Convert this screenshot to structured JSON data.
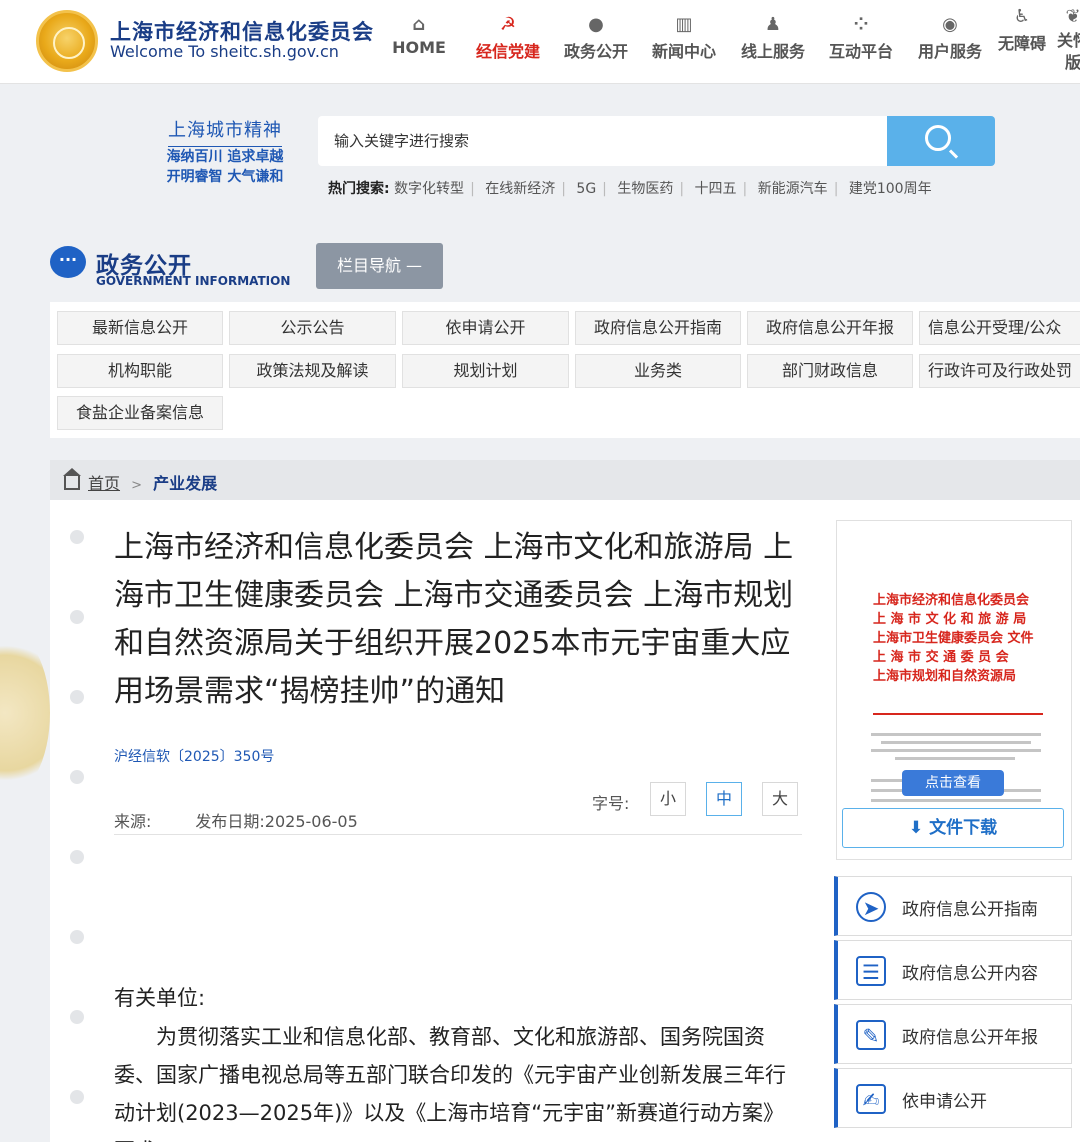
{
  "header": {
    "site_title_cn": "上海市经济和信息化委员会",
    "site_title_en": "Welcome To sheitc.sh.gov.cn",
    "nav": [
      {
        "label": "HOME",
        "icon": "home-icon",
        "glyph": "⌂"
      },
      {
        "label": "经信党建",
        "icon": "party-emblem-icon",
        "glyph": "☭"
      },
      {
        "label": "政务公开",
        "icon": "chat-icon",
        "glyph": "●"
      },
      {
        "label": "新闻中心",
        "icon": "books-icon",
        "glyph": "▥"
      },
      {
        "label": "线上服务",
        "icon": "user-service-icon",
        "glyph": "♟"
      },
      {
        "label": "互动平台",
        "icon": "interact-icon",
        "glyph": "⁘"
      },
      {
        "label": "用户服务",
        "icon": "user-icon",
        "glyph": "◉"
      },
      {
        "label": "无障碍",
        "icon": "accessibility-icon",
        "glyph": "♿"
      },
      {
        "label": "关怀版",
        "icon": "care-icon",
        "glyph": "❦"
      }
    ]
  },
  "spirit": {
    "title": "上海城市精神",
    "line1": "海纳百川 追求卓越",
    "line2": "开明睿智 大气谦和"
  },
  "search": {
    "placeholder": "输入关键字进行搜索",
    "hot_label": "热门搜索:",
    "hot_keywords": [
      "数字化转型",
      "在线新经济",
      "5G",
      "生物医药",
      "十四五",
      "新能源汽车",
      "建党100周年"
    ]
  },
  "gov_info": {
    "title_cn": "政务公开",
    "title_en": "GOVERNMENT INFORMATION",
    "column_nav": "栏目导航 —"
  },
  "categories": [
    "最新信息公开",
    "公示公告",
    "依申请公开",
    "政府信息公开指南",
    "政府信息公开年报",
    "信息公开受理/公众",
    "机构职能",
    "政策法规及解读",
    "规划计划",
    "业务类",
    "部门财政信息",
    "行政许可及行政处罚",
    "食盐企业备案信息"
  ],
  "breadcrumb": {
    "home": "首页",
    "sep": ">",
    "current": "产业发展"
  },
  "article": {
    "title": "上海市经济和信息化委员会 上海市文化和旅游局 上海市卫生健康委员会 上海市交通委员会 上海市规划和自然资源局关于组织开展2025本市元宇宙重大应用场景需求“揭榜挂帅”的通知",
    "doc_no": "沪经信软〔2025〕350号",
    "source_label": "来源:",
    "date_label": "发布日期:2025-06-05",
    "font_size_label": "字号:",
    "font_sizes": [
      "小",
      "中",
      "大"
    ],
    "addressee": "有关单位:",
    "body": "为贯彻落实工业和信息化部、教育部、文化和旅游部、国务院国资委、国家广播电视总局等五部门联合印发的《元宇宙产业创新发展三年行动计划(2023—2025年)》以及《上海市培育“元宇宙”新赛道行动方案》要求"
  },
  "thumbnail": {
    "issuers": [
      "上海市经济和信息化委员会",
      "上 海 市 文 化 和 旅 游 局",
      "上海市卫生健康委员会 文件",
      "上 海 市 交 通 委 员 会",
      "上海市规划和自然资源局"
    ],
    "view_button": "点击查看",
    "download_button": "文件下载"
  },
  "side_nav": [
    {
      "label": "政府信息公开指南",
      "icon": "compass-icon",
      "glyph": "➤"
    },
    {
      "label": "政府信息公开内容",
      "icon": "list-icon",
      "glyph": "☰"
    },
    {
      "label": "政府信息公开年报",
      "icon": "report-icon",
      "glyph": "✎"
    },
    {
      "label": "依申请公开",
      "icon": "form-icon",
      "glyph": "✍"
    }
  ],
  "colors": {
    "brand_blue": "#1a3d86",
    "accent_blue": "#5ab1ea",
    "party_red": "#d7261d"
  }
}
